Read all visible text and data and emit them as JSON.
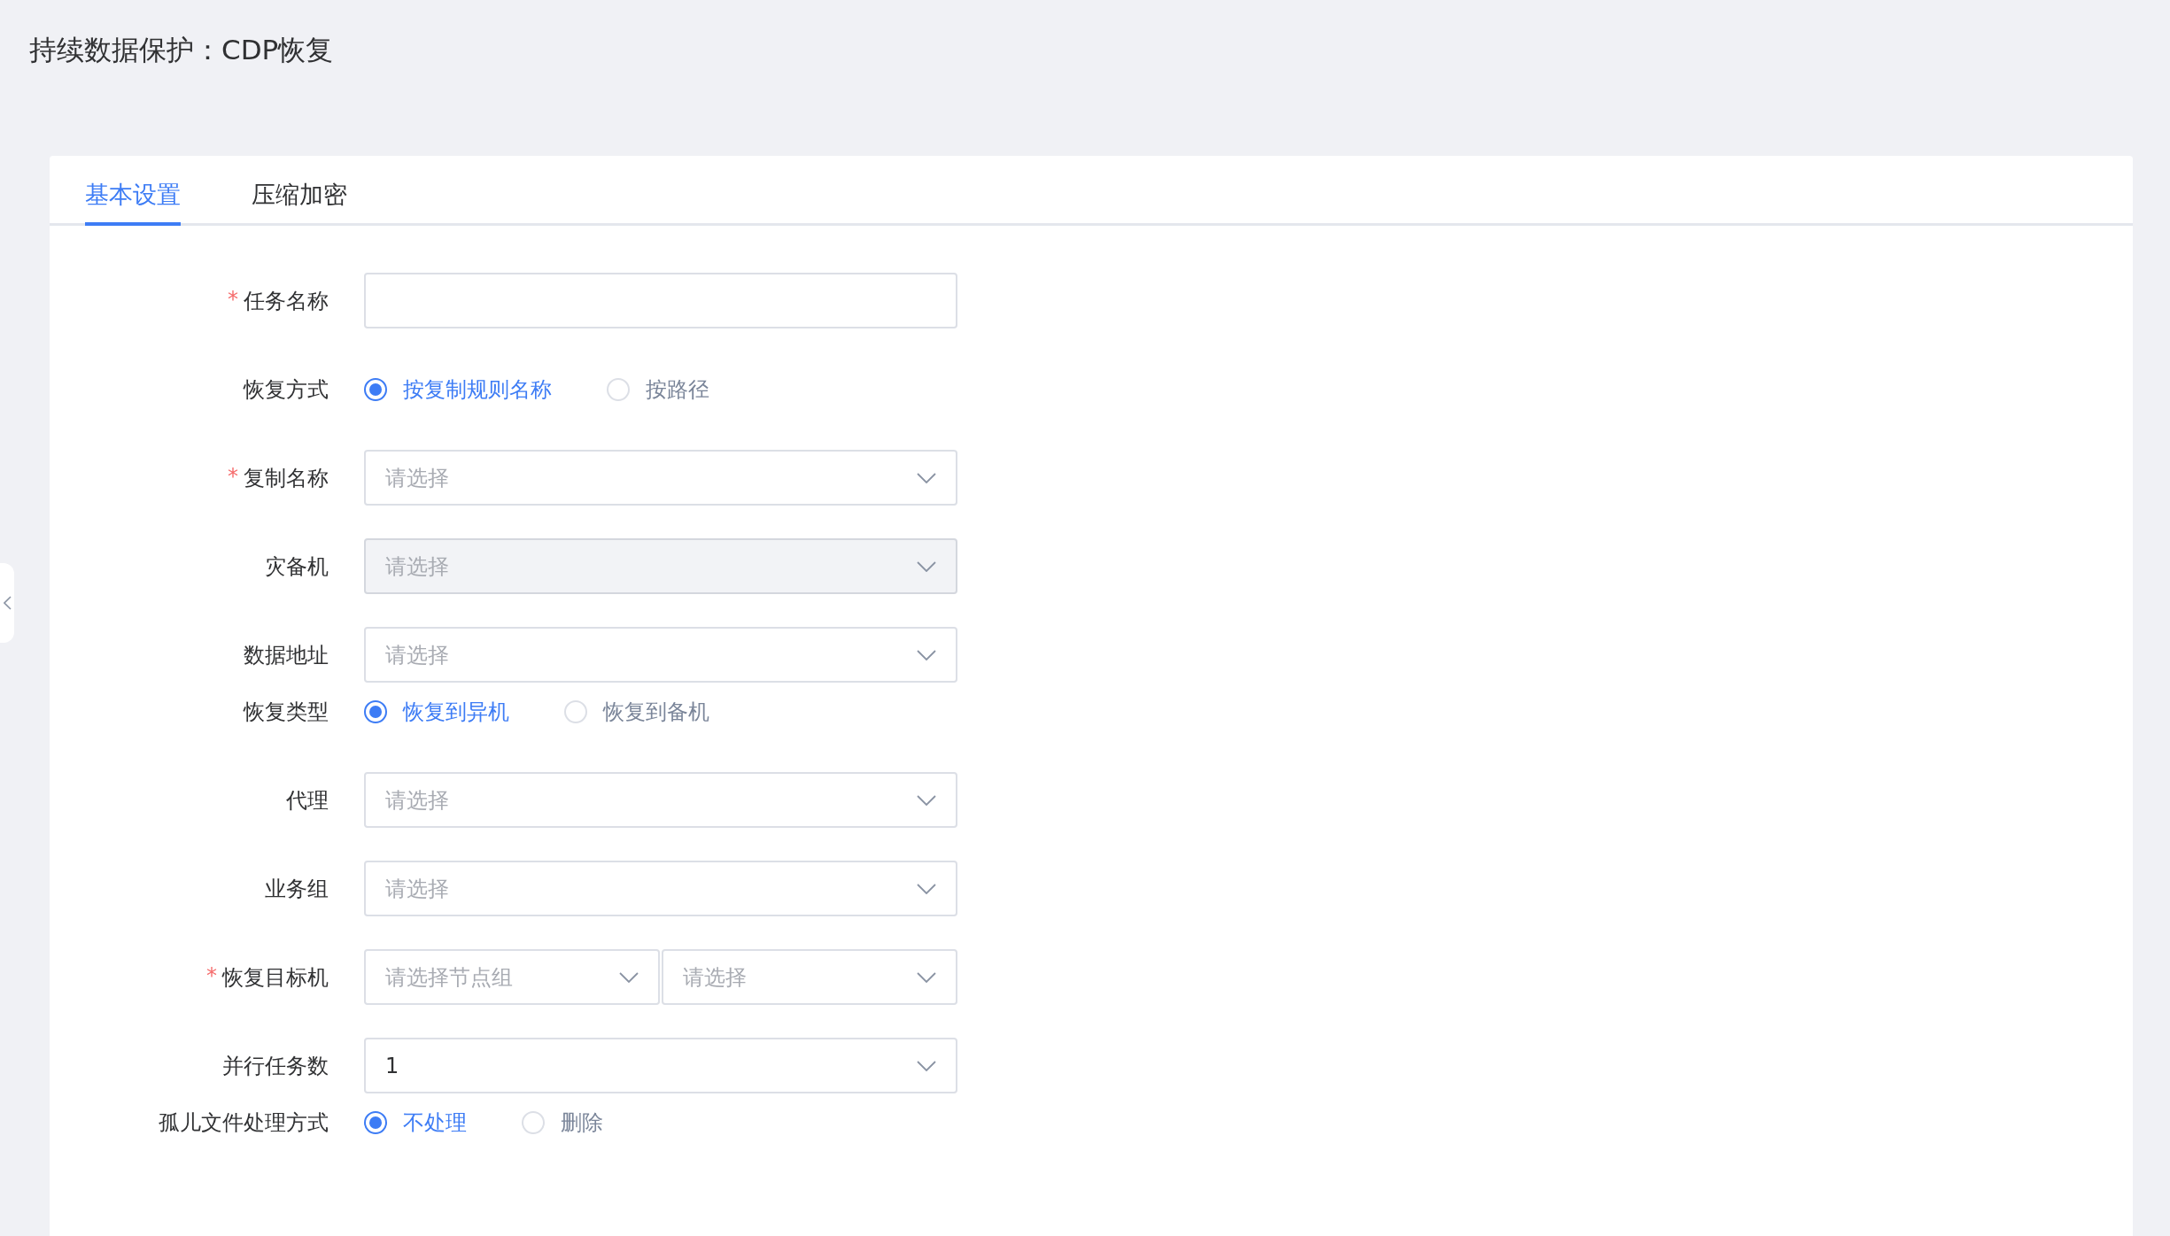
{
  "page_title": "持续数据保护：CDP恢复",
  "tabs": [
    {
      "label": "基本设置",
      "selected": true
    },
    {
      "label": "压缩加密",
      "selected": false
    }
  ],
  "form": [
    {
      "kind": "input",
      "label": "任务名称",
      "required_mark": "*"
    },
    {
      "kind": "radio",
      "label": "恢复方式",
      "options": [
        {
          "label": "按复制规则名称",
          "selected": true
        },
        {
          "label": "按路径",
          "selected": false
        }
      ]
    },
    {
      "kind": "select",
      "label": "复制名称",
      "required_mark": "*",
      "placeholder": "请选择"
    },
    {
      "kind": "select",
      "label": "灾备机",
      "placeholder": "请选择",
      "disabled": true
    },
    {
      "kind": "select",
      "label": "数据地址",
      "placeholder": "请选择"
    },
    {
      "kind": "radio",
      "label": "恢复类型",
      "options": [
        {
          "label": "恢复到异机",
          "selected": true
        },
        {
          "label": "恢复到备机",
          "selected": false
        }
      ]
    },
    {
      "kind": "select",
      "label": "代理",
      "placeholder": "请选择"
    },
    {
      "kind": "select",
      "label": "业务组",
      "placeholder": "请选择"
    },
    {
      "kind": "dual-select",
      "label": "恢复目标机",
      "required_mark": "*",
      "selects": [
        {
          "placeholder": "请选择节点组"
        },
        {
          "placeholder": "请选择"
        }
      ]
    },
    {
      "kind": "select",
      "label": "并行任务数",
      "value": "1"
    },
    {
      "kind": "radio",
      "label": "孤儿文件处理方式",
      "options": [
        {
          "label": "不处理",
          "selected": true
        },
        {
          "label": "删除",
          "selected": false
        }
      ]
    }
  ]
}
